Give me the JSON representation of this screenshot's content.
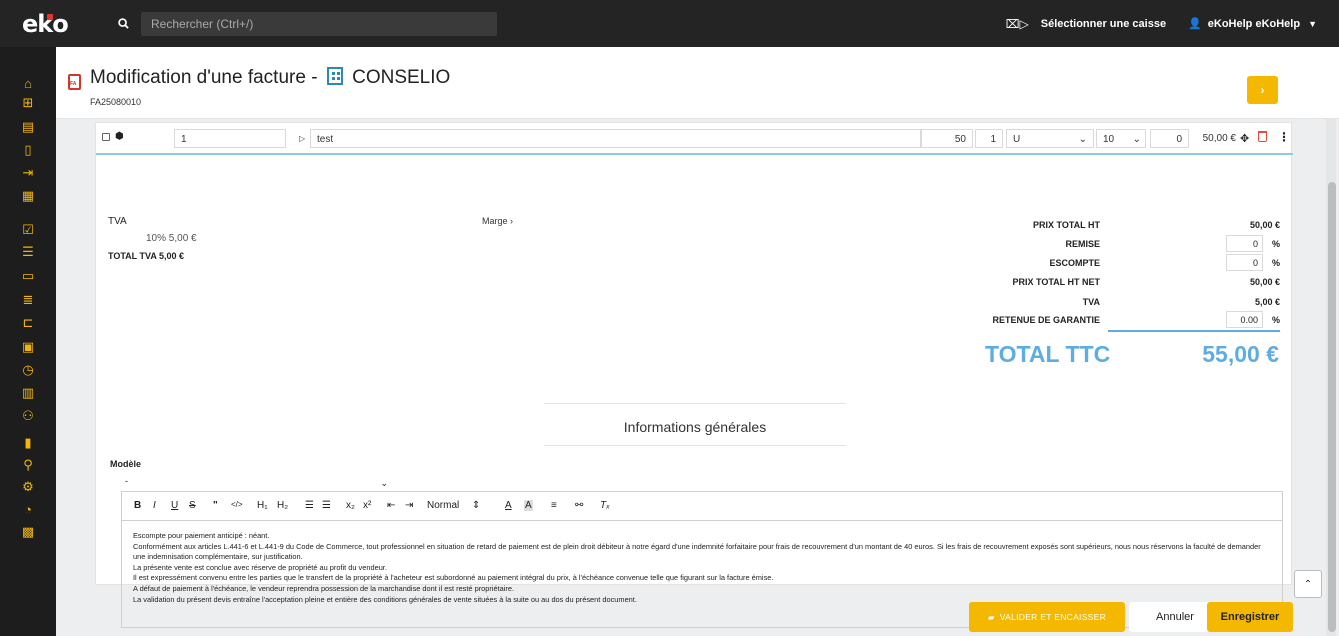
{
  "app": {
    "logo": "eko"
  },
  "topbar": {
    "search_placeholder": "Rechercher (Ctrl+/)",
    "caisse_label": "Sélectionner une caisse",
    "user_label": "eKoHelp eKoHelp"
  },
  "sidebar": {
    "icons": [
      "home-icon",
      "add-square-icon",
      "document-icon",
      "file-icon",
      "file-export-icon",
      "calendar-icon",
      "calendar-check-icon",
      "list-icon",
      "folder-open-icon",
      "tasks-icon",
      "hierarchy-icon",
      "briefcase-icon",
      "stopwatch-icon",
      "receipt-icon",
      "users-icon",
      "bar-chart-icon",
      "search-icon",
      "settings-icon",
      "help-icon",
      "calculator-icon"
    ]
  },
  "header": {
    "title_prefix": "Modification d'une facture -",
    "client": "CONSELIO",
    "doc_number": "FA25080010"
  },
  "line": {
    "position": "1",
    "designation": "test",
    "price": "50",
    "quantity": "1",
    "unit": "U",
    "tva": "10",
    "discount": "0",
    "total": "50,00 €"
  },
  "tva": {
    "label": "TVA",
    "rate_line": "10%  5,00 €",
    "total_line": "TOTAL TVA  5,00 €"
  },
  "marge_label": "Marge",
  "totals": {
    "prix_total_ht_label": "PRIX TOTAL HT",
    "prix_total_ht": "50,00 €",
    "remise_label": "REMISE",
    "remise": "0",
    "escompte_label": "ESCOMPTE",
    "escompte": "0",
    "prix_total_ht_net_label": "PRIX TOTAL HT NET",
    "prix_total_ht_net": "50,00 €",
    "tva_label": "TVA",
    "tva": "5,00 €",
    "retenue_label": "RETENUE DE GARANTIE",
    "retenue": "0.00",
    "percent": "%",
    "ttc_label": "TOTAL TTC",
    "ttc": "55,00 €"
  },
  "info": {
    "title": "Informations générales",
    "modele_label": "Modèle",
    "modele_value": "-"
  },
  "editor": {
    "toolbar_format": "Normal",
    "lines": [
      "Escompte pour paiement anticipé : néant.",
      "Conformément aux articles L.441-6 et L.441-9 du Code de Commerce, tout professionnel en situation de retard de paiement est de plein droit débiteur à notre égard d'une indemnité forfaitaire pour frais de recouvrement d'un montant de 40 euros. Si les frais de recouvrement exposés sont supérieurs, nous nous réservons la faculté de demander une indemnisation complémentaire, sur justification.",
      "La présente vente est conclue avec réserve de propriété au profit du vendeur.",
      "Il est expressément convenu entre les parties que le transfert de la propriété à l'acheteur est subordonné au paiement intégral du prix, à l'échéance convenue telle que figurant sur la facture émise.",
      "A défaut de paiement à l'échéance, le vendeur reprendra possession de la marchandise dont il est resté propriétaire.",
      "La validation du présent devis entraîne l'acceptation pleine et entière des conditions générales de vente situées à la suite ou au dos du présent document."
    ]
  },
  "footer": {
    "valider_label": "VALIDER ET ENCAISSER",
    "annuler_label": "Annuler",
    "enregistrer_label": "Enregistrer"
  },
  "colors": {
    "accent": "#f5b800",
    "ttc_blue": "#5dade2",
    "sidebar_icon": "#f2b705",
    "topbar_bg": "#242424"
  }
}
